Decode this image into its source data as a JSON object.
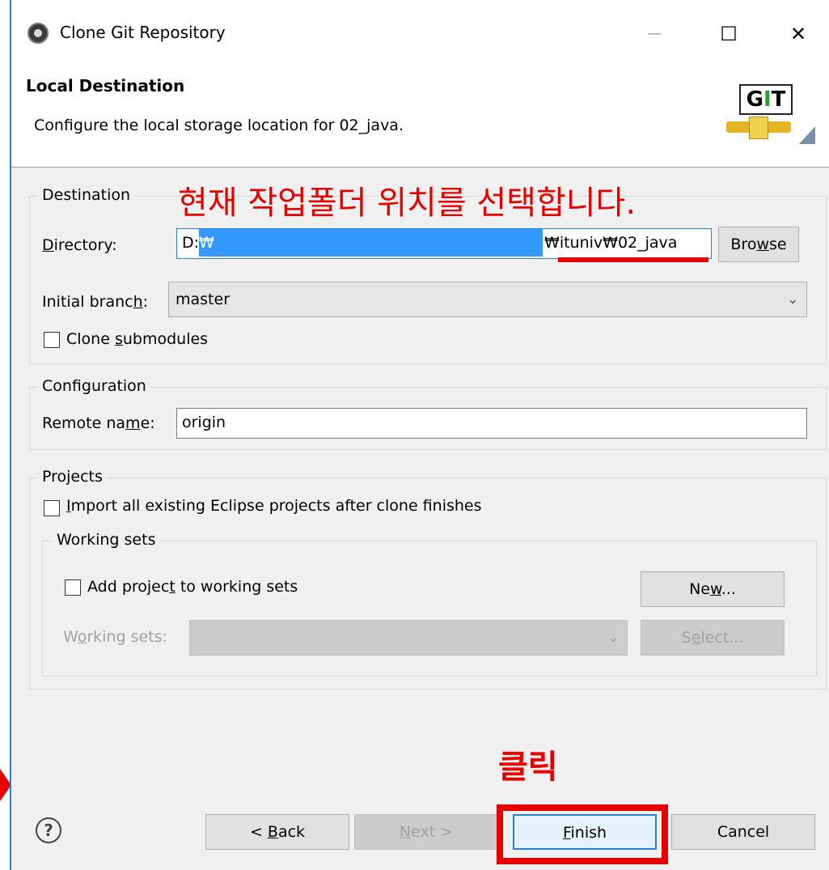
{
  "window": {
    "title": "Clone Git Repository",
    "minimize_glyph": "—",
    "maximize_glyph": "☐",
    "close_glyph": "✕"
  },
  "header": {
    "title": "Local Destination",
    "description": "Configure the local storage location for 02_java.",
    "logo_text_g": "G",
    "logo_text_i": "I",
    "logo_text_t": "T"
  },
  "destination": {
    "legend": "Destination",
    "directory_label_first": "D",
    "directory_label_rest": "irectory:",
    "directory_value_start": "D:",
    "directory_value_highlight": "₩",
    "directory_value_end": "₩ituniv₩02_java",
    "browse_first": "Bro",
    "browse_mnemonic": "w",
    "browse_rest": "se",
    "branch_label_start": "Initial branc",
    "branch_label_mnemonic": "h",
    "branch_label_end": ":",
    "branch_value": "master",
    "clone_submodules_start": "Clone ",
    "clone_submodules_mnemonic": "s",
    "clone_submodules_end": "ubmodules",
    "clone_submodules_checked": false
  },
  "configuration": {
    "legend": "Configuration",
    "remote_label_start": "Remote na",
    "remote_label_mnemonic": "m",
    "remote_label_end": "e:",
    "remote_value": "origin"
  },
  "projects": {
    "legend": "Projects",
    "import_mnemonic": "I",
    "import_rest": "mport all existing Eclipse projects after clone finishes",
    "import_checked": false,
    "working_sets_legend": "Working sets",
    "add_to_ws_start": "Add projec",
    "add_to_ws_mnemonic": "t",
    "add_to_ws_end": " to working sets",
    "add_to_ws_checked": false,
    "new_start": "Ne",
    "new_mnemonic": "w",
    "new_end": "...",
    "ws_label_start": "W",
    "ws_label_mnemonic": "o",
    "ws_label_end": "rking sets:",
    "ws_value": "",
    "select_start": "S",
    "select_mnemonic": "e",
    "select_end": "lect..."
  },
  "footer": {
    "help_glyph": "?",
    "back_start": "< ",
    "back_mnemonic": "B",
    "back_end": "ack",
    "next_mnemonic": "N",
    "next_end": "ext >",
    "finish_mnemonic": "F",
    "finish_end": "inish",
    "cancel": "Cancel"
  },
  "annotations": {
    "select_folder_text": "현재 작업폴더 위치를 선택합니다.",
    "click_text": "클릭",
    "color": "#e60000"
  }
}
